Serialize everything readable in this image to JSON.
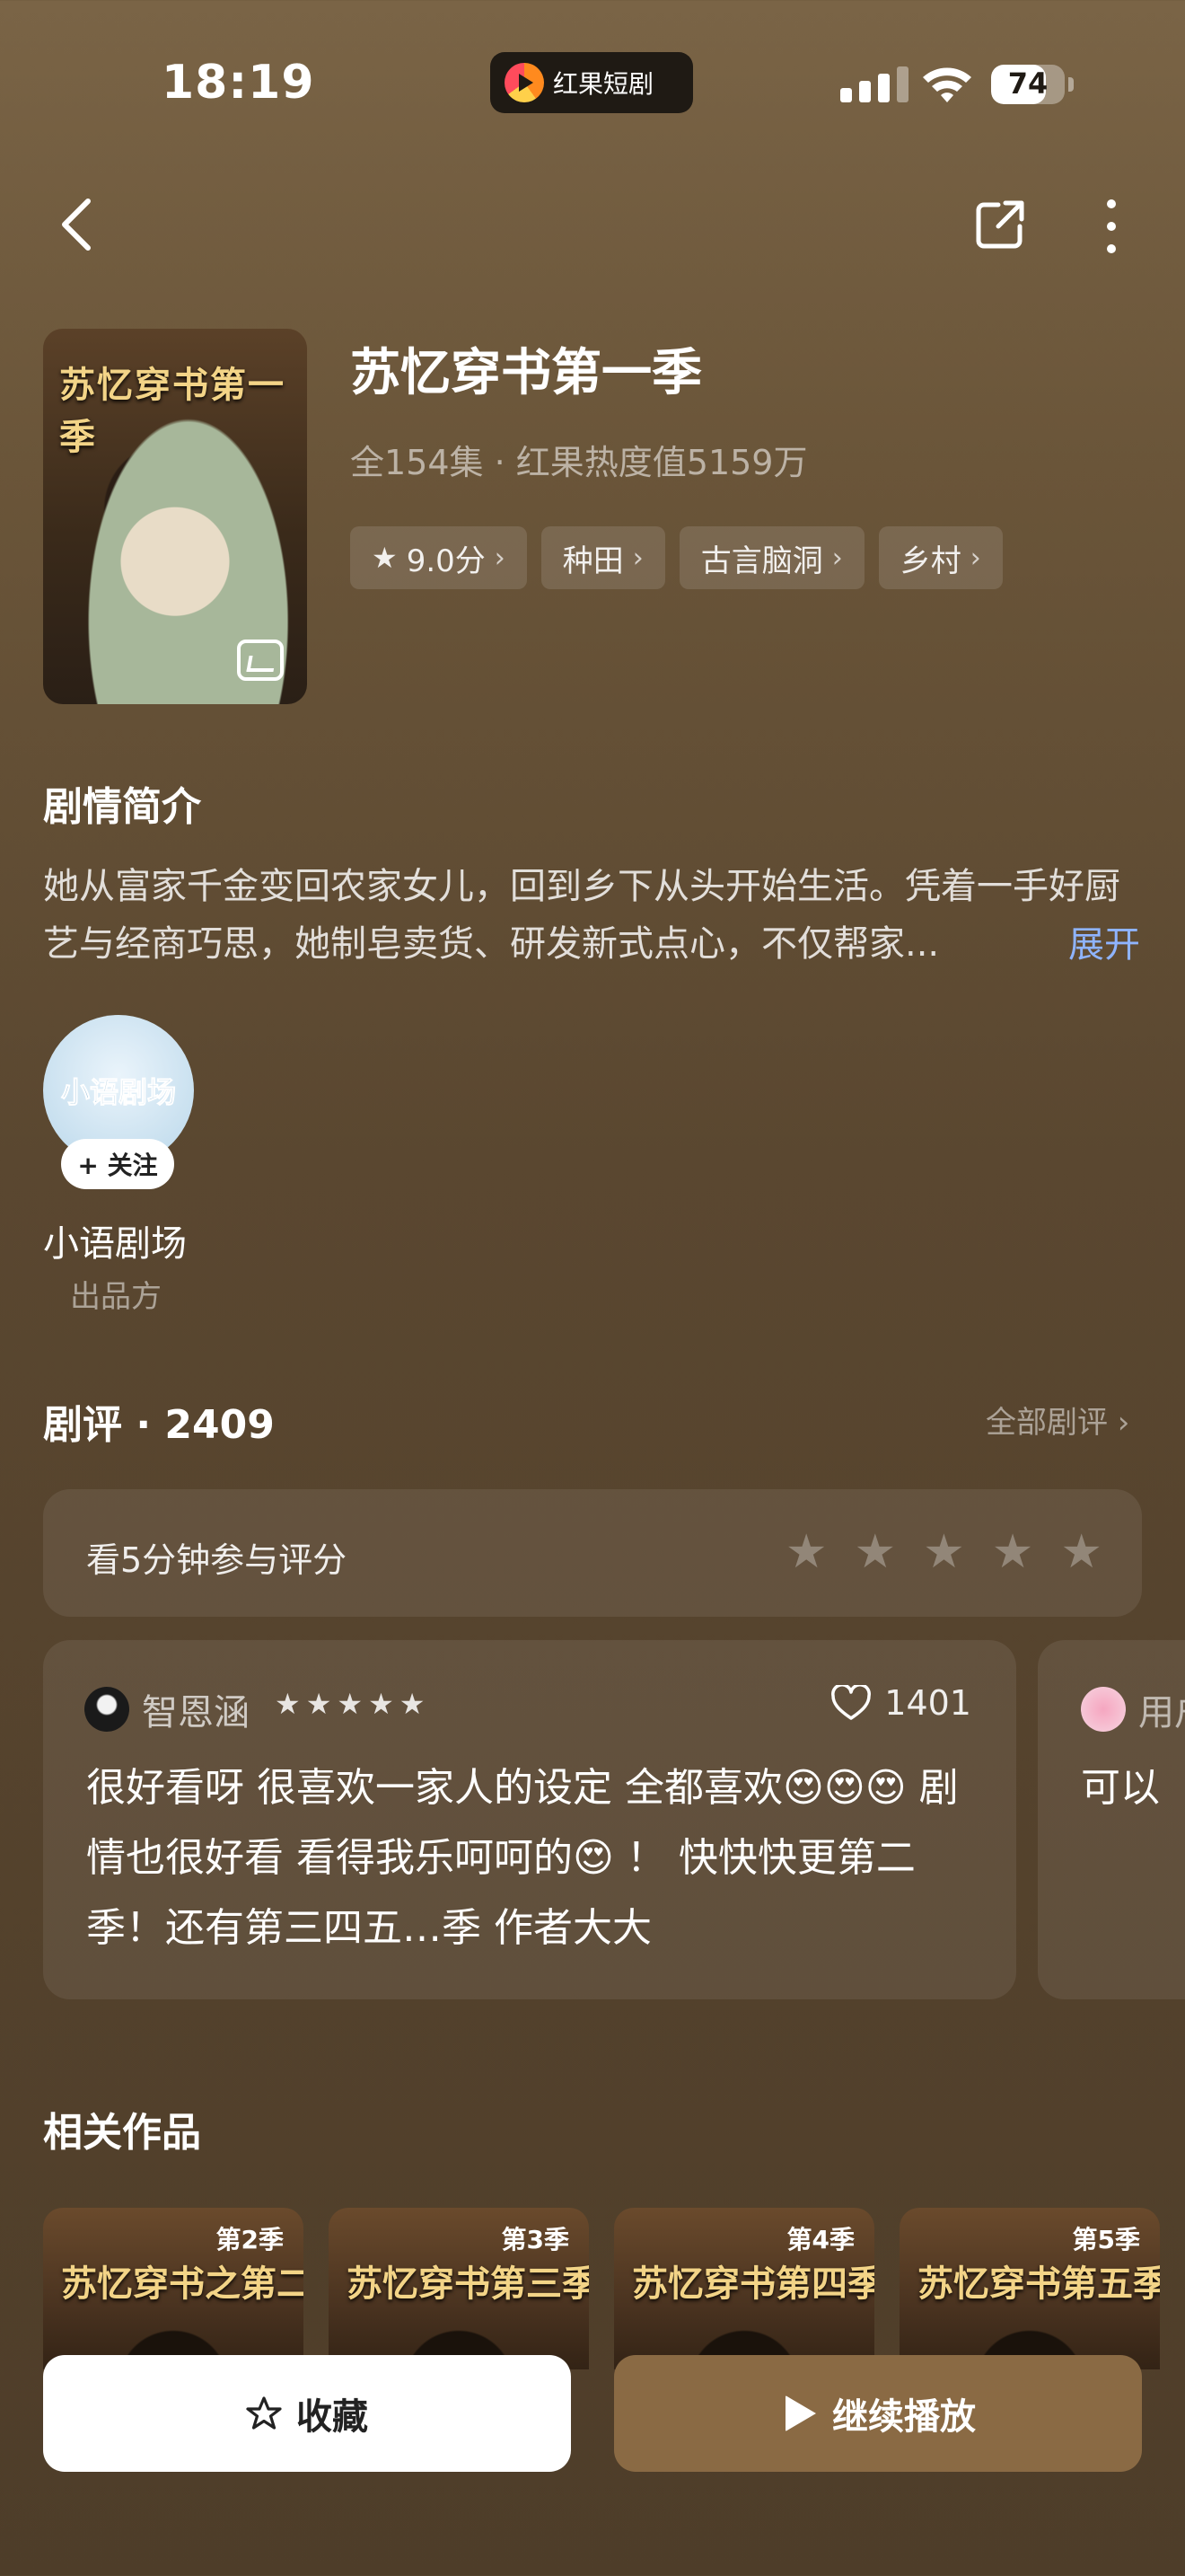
{
  "status_bar": {
    "time": "18:19",
    "app_name": "红果短剧",
    "battery": "74",
    "battery_level": 0.74
  },
  "drama": {
    "cover_title": "苏忆穿书第一季",
    "title": "苏忆穿书第一季",
    "meta": "全154集 · 红果热度值5159万",
    "tags": [
      {
        "label": "9.0分",
        "icon": "star-icon"
      },
      {
        "label": "种田"
      },
      {
        "label": "古言脑洞"
      },
      {
        "label": "乡村"
      }
    ]
  },
  "synopsis": {
    "heading": "剧情简介",
    "text": "她从富家千金变回农家女儿，回到乡下从头开始生活。凭着一手好厨艺与经商巧思，她制皂卖货、研发新式点心，不仅帮家...",
    "expand_label": "展开"
  },
  "producer": {
    "avatar_text": "小语剧场",
    "follow_label": "+ 关注",
    "name": "小语剧场",
    "role": "出品方"
  },
  "reviews": {
    "heading": "剧评 · 2409",
    "all_label": "全部剧评 ›",
    "rate_prompt": "看5分钟参与评分",
    "rating_stars": 5,
    "items": [
      {
        "user": "智恩涵",
        "stars": "★★★★★",
        "likes": "1401",
        "text": "很好看呀 很喜欢一家人的设定 全都喜欢😍😍😍 剧情也很好看 看得我乐呵呵的😍 ！ 快快快更第二季！还有第三四五…季 作者大大"
      },
      {
        "user": "用户",
        "text": "可以"
      }
    ]
  },
  "related": {
    "heading": "相关作品",
    "items": [
      {
        "badge": "第2季",
        "title": "苏忆穿书之第二季"
      },
      {
        "badge": "第3季",
        "title": "苏忆穿书第三季"
      },
      {
        "badge": "第4季",
        "title": "苏忆穿书第四季"
      },
      {
        "badge": "第5季",
        "title": "苏忆穿书第五季"
      }
    ]
  },
  "actions": {
    "favorite_label": "收藏",
    "play_label": "继续播放"
  }
}
